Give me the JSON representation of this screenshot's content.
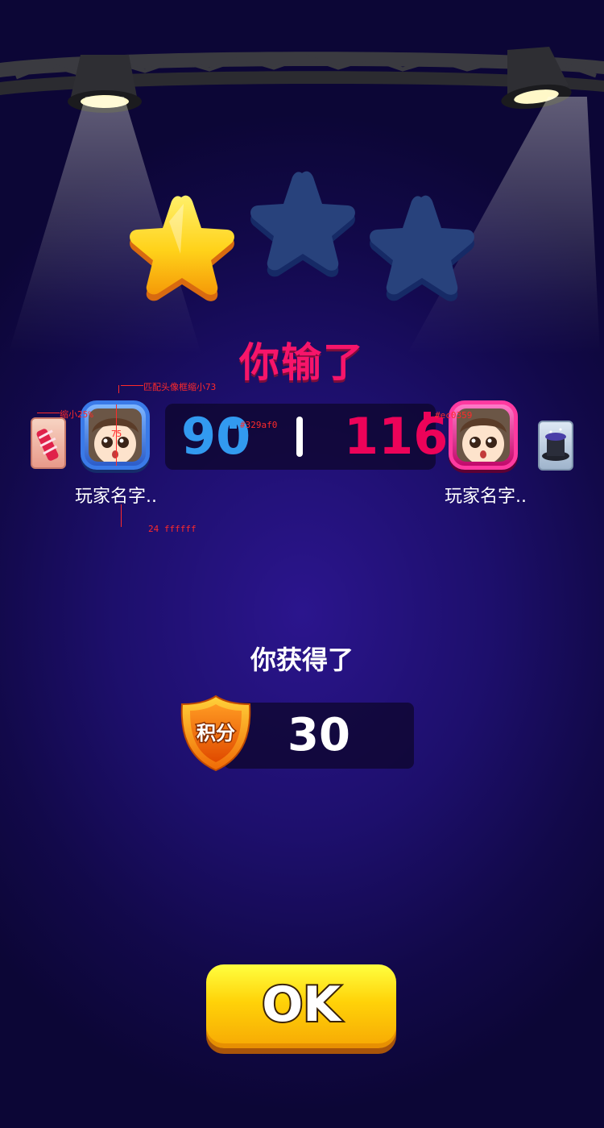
{
  "result": {
    "title": "你输了",
    "stars_earned": 1,
    "stars_total": 3
  },
  "players": [
    {
      "name": "玩家名字..",
      "score": "90",
      "color": "#329af0",
      "item_icon": "firecracker-icon"
    },
    {
      "name": "玩家名字..",
      "score": "116",
      "color": "#ec0359",
      "item_icon": "magic-hat-icon"
    }
  ],
  "annotations": {
    "avatar_frame_note": "匹配头像框缩小73",
    "item_scale_note": "缩小25%",
    "avatar_size": "75",
    "blue_color": "#329af0",
    "red_color": "#ec0359",
    "name_font_note": "24 ffffff"
  },
  "reward": {
    "label": "你获得了",
    "badge_text": "积分",
    "points": "30"
  },
  "buttons": {
    "ok_label": "OK"
  },
  "colors": {
    "title": "#f6156a",
    "ok_button": "#ffd208",
    "background": "#1d0f6c"
  }
}
